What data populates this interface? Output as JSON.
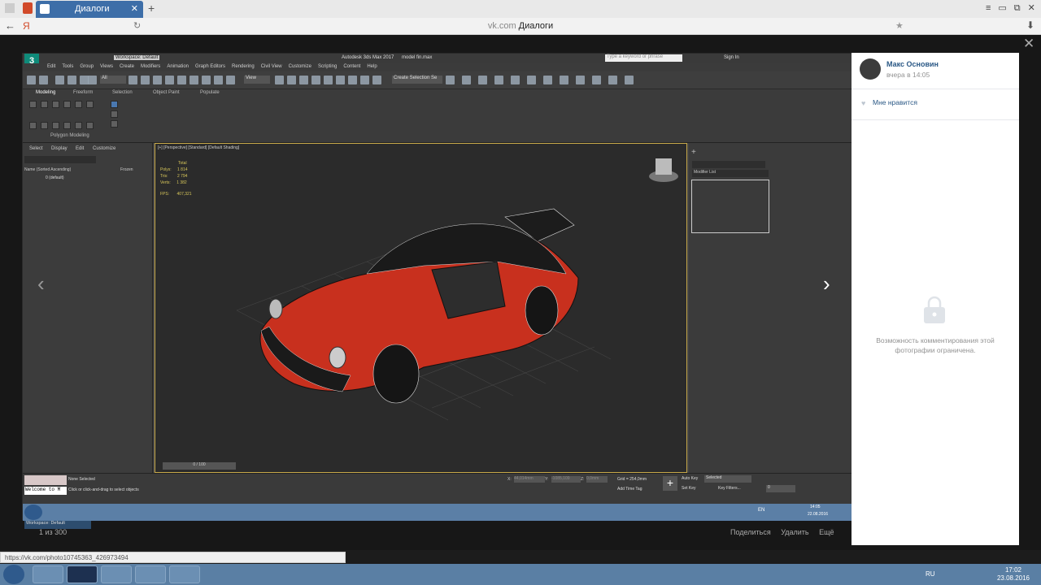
{
  "browser": {
    "tab_title": "Диалоги",
    "url_domain": "vk.com",
    "url_title": "Диалоги",
    "status_url": "https://vk.com/photo10745363_426973494"
  },
  "max": {
    "workspace": "Workspace: Default",
    "app_title": "Autodesk 3ds Max 2017",
    "file": "model fin.max",
    "search_placeholder": "Type a keyword or phrase",
    "sign_in": "Sign In",
    "menu": [
      "Edit",
      "Tools",
      "Group",
      "Views",
      "Create",
      "Modifiers",
      "Animation",
      "Graph Editors",
      "Rendering",
      "Civil View",
      "Customize",
      "Scripting",
      "Content",
      "Help"
    ],
    "ribbon_tabs": [
      "Modeling",
      "Freeform",
      "Selection",
      "Object Paint",
      "Populate"
    ],
    "ribbon_group": "Polygon Modeling",
    "toolbar_filter": "All",
    "view_select": "View",
    "create_selection": "Create Selection Se",
    "scene_menu": [
      "Select",
      "Display",
      "Edit",
      "Customize"
    ],
    "scene_col_name": "Name (Sorted Ascending)",
    "scene_col_frozen": "Frozen",
    "scene_item": "0 (default)",
    "viewport_label": "[+] [Perspective] [Standard] [Default Shading]",
    "stats": {
      "total_label": "Total",
      "polys_label": "Polys:",
      "polys": "1 814",
      "tris_label": "Tris:",
      "tris": "2 794",
      "verts_label": "Verts:",
      "verts": "1 382",
      "fps_label": "FPS:",
      "fps": "407,321"
    },
    "modifier_list": "Modifier List",
    "timeline": "0 / 100",
    "status_none": "None Selected",
    "status_hint": "Click or click-and-drag to select objects",
    "welcome": "Welcome to M",
    "coord_x_label": "X:",
    "coord_x": "44,014mm",
    "coord_y_label": "Y:",
    "coord_y": "-1085,109",
    "coord_z_label": "Z:",
    "coord_z": "0,0mm",
    "grid": "Grid = 254,0mm",
    "add_time_tag": "Add Time Tag",
    "auto_key": "Auto Key",
    "set_key": "Set Key",
    "selected": "Selected",
    "key_filters": "Key Filters...",
    "frame": "0",
    "inner_lang": "EN",
    "inner_time": "14:05",
    "inner_date": "22.08.2016"
  },
  "vk": {
    "author": "Макс Основин",
    "time": "вчера в 14:05",
    "like": "Мне нравится",
    "comments_restricted": "Возможность комментирования этой фотографии ограничена."
  },
  "viewer": {
    "counter": "1 из 300",
    "share": "Поделиться",
    "delete": "Удалить",
    "more": "Ещё"
  },
  "taskbar": {
    "lang": "RU",
    "time": "17:02",
    "date": "23.08.2016"
  },
  "colors": {
    "vk_link": "#2a5885",
    "taskbar": "#5a7fa4",
    "car": "#c8301e"
  }
}
